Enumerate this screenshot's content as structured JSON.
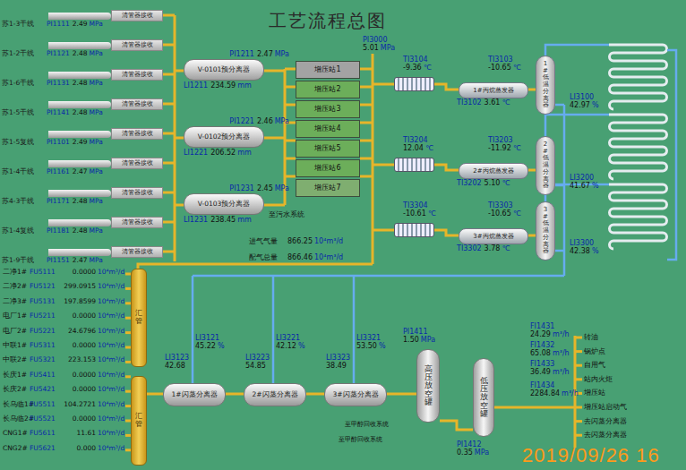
{
  "title": "工艺流程总图",
  "inlets": [
    {
      "name": "苏1-3干线",
      "tag": "PI1111",
      "value": "2.49",
      "unit": "MPa",
      "receiver": "清管器接收"
    },
    {
      "name": "苏1-2干线",
      "tag": "PI1121",
      "value": "2.48",
      "unit": "MPa",
      "receiver": "清管器接收"
    },
    {
      "name": "苏1-6干线",
      "tag": "PI1131",
      "value": "2.48",
      "unit": "MPa",
      "receiver": "清管器接收"
    },
    {
      "name": "苏1-5干线",
      "tag": "PI1141",
      "value": "2.48",
      "unit": "MPa",
      "receiver": "清管器接收"
    },
    {
      "name": "苏1-5复线",
      "tag": "PI1101",
      "value": "2.49",
      "unit": "MPa",
      "receiver": "清管器接收"
    },
    {
      "name": "苏1-4干线",
      "tag": "PI1161",
      "value": "2.47",
      "unit": "MPa",
      "receiver": "清管器接收"
    },
    {
      "name": "苏4-3干线",
      "tag": "PI1171",
      "value": "2.48",
      "unit": "MPa",
      "receiver": "清管器接收"
    },
    {
      "name": "苏1-4复线",
      "tag": "PI1181",
      "value": "2.48",
      "unit": "MPa",
      "receiver": "清管器接收"
    },
    {
      "name": "苏1-9干线",
      "tag": "PI1151",
      "value": "2.47",
      "unit": "MPa",
      "receiver": "清管器接收"
    }
  ],
  "separators": [
    {
      "name": "V-0101预分离器",
      "pressure_tag": "PI1211",
      "pressure": "2.47",
      "pressure_unit": "MPa",
      "level_tag": "LI1211",
      "level": "234.59",
      "level_unit": "mm"
    },
    {
      "name": "V-0102预分离器",
      "pressure_tag": "PI1221",
      "pressure": "2.46",
      "pressure_unit": "MPa",
      "level_tag": "LI1221",
      "level": "206.52",
      "level_unit": "mm"
    },
    {
      "name": "V-0103预分离器",
      "pressure_tag": "PI1231",
      "pressure": "2.45",
      "pressure_unit": "MPa",
      "level_tag": "LI1231",
      "level": "238.45",
      "level_unit": "mm"
    }
  ],
  "drain_label": "至污水系统",
  "boosters": {
    "outlet_tag": "PI3000",
    "outlet_value": "5.01",
    "outlet_unit": "MPa",
    "stations": [
      {
        "name": "增压站1",
        "color": "#a3a3a3"
      },
      {
        "name": "增压站2",
        "color": "#6cae5a"
      },
      {
        "name": "增压站3",
        "color": "#6cae5a"
      },
      {
        "name": "增压站4",
        "color": "#6cae5a"
      },
      {
        "name": "增压站5",
        "color": "#6cae5a"
      },
      {
        "name": "增压站6",
        "color": "#6cae5a"
      },
      {
        "name": "增压站7",
        "color": "#7fae70"
      }
    ]
  },
  "totals": [
    {
      "label": "进气气量",
      "value": "866.25",
      "unit": "10⁴m³/d"
    },
    {
      "label": "配气总量",
      "value": "866.46",
      "unit": "10⁴m³/d"
    }
  ],
  "trains": [
    {
      "inlet_tag": "TI3104",
      "inlet_value": "-9.36",
      "evap_tag": "TI3103",
      "evap_value": "-10.65",
      "evaporator": "1#丙烷蒸发器",
      "out_tag": "TI3102",
      "out_value": "3.61",
      "unit": "℃",
      "separator": "1#低温分离器",
      "level_tag": "LI3100",
      "level_value": "42.97",
      "level_unit": "%"
    },
    {
      "inlet_tag": "TI3204",
      "inlet_value": "12.04",
      "evap_tag": "TI3203",
      "evap_value": "-11.92",
      "evaporator": "2#丙烷蒸发器",
      "out_tag": "TI3202",
      "out_value": "5.10",
      "unit": "℃",
      "separator": "2#低温分离器",
      "level_tag": "LI3200",
      "level_value": "41.67",
      "level_unit": "%"
    },
    {
      "inlet_tag": "TI3304",
      "inlet_value": "-10.61",
      "evap_tag": "TI3303",
      "evap_value": "-10.65",
      "evaporator": "3#丙烷蒸发器",
      "out_tag": "TI3302",
      "out_value": "3.78",
      "unit": "℃",
      "separator": "3#低温分离器",
      "level_tag": "LI3300",
      "level_value": "42.38",
      "level_unit": "%"
    }
  ],
  "flows": [
    {
      "name": "二净1#",
      "tag": "FU5111",
      "value": "0.0000",
      "unit": "10⁴m³/d"
    },
    {
      "name": "二净2#",
      "tag": "FU5121",
      "value": "299.0915",
      "unit": "10⁴m³/d"
    },
    {
      "name": "二净3#",
      "tag": "FU5131",
      "value": "197.8599",
      "unit": "10⁴m³/d"
    },
    {
      "name": "电厂1#",
      "tag": "FU5211",
      "value": "0.0000",
      "unit": "10⁴m³/d"
    },
    {
      "name": "电厂2#",
      "tag": "FU5221",
      "value": "24.6796",
      "unit": "10⁴m³/d"
    },
    {
      "name": "中联1#",
      "tag": "FU5311",
      "value": "0.0000",
      "unit": "10⁴m³/d"
    },
    {
      "name": "中联2#",
      "tag": "FU5321",
      "value": "223.153",
      "unit": "10⁴m³/d"
    },
    {
      "name": "长庆1#",
      "tag": "FU5411",
      "value": "0.0000",
      "unit": "10⁴m³/d"
    },
    {
      "name": "长庆2#",
      "tag": "FU5421",
      "value": "0.0000",
      "unit": "10⁴m³/d"
    },
    {
      "name": "长乌临1#",
      "tag": "FU5511",
      "value": "104.2721",
      "unit": "10⁴m³/d"
    },
    {
      "name": "长乌临2#",
      "tag": "FU5521",
      "value": "0.0000",
      "unit": "10⁴m³/d"
    },
    {
      "name": "CNG1#",
      "tag": "FU5611",
      "value": "11.61",
      "unit": "10⁴m³/d"
    },
    {
      "name": "CNG2#",
      "tag": "FU5621",
      "value": "0.000",
      "unit": "10⁴m³/d"
    }
  ],
  "headers": [
    "汇管",
    "汇管"
  ],
  "flash": [
    {
      "name": "1#闪蒸分离器",
      "tag_a": "LI3123",
      "value_a": "42.68",
      "tag_b": "LI3121",
      "value_b": "45.22",
      "unit": "%"
    },
    {
      "name": "2#闪蒸分离器",
      "tag_a": "LI3223",
      "value_a": "54.85",
      "tag_b": "LI3221",
      "value_b": "42.12",
      "unit": "%"
    },
    {
      "name": "3#闪蒸分离器",
      "tag_a": "LI3323",
      "value_a": "38.49",
      "tag_b": "LI3321",
      "value_b": "53.50",
      "unit": "%"
    }
  ],
  "methanol_labels": [
    "至甲醇回收系统",
    "至甲醇回收系统"
  ],
  "hp_tank": {
    "name": "高压放空罐",
    "tag": "PI1411",
    "value": "1.50",
    "unit": "MPa"
  },
  "lp_tank": {
    "name": "低压放空罐",
    "tag": "PI1412",
    "value": "0.35",
    "unit": "MPa"
  },
  "consumers": {
    "meters": [
      {
        "tag": "FI1431",
        "value": "24.29",
        "unit": "m³/h"
      },
      {
        "tag": "FI1432",
        "value": "65.08",
        "unit": "m³/h"
      },
      {
        "tag": "FI1433",
        "value": "36.49",
        "unit": "m³/h"
      },
      {
        "tag": "FI1434",
        "value": "2284.84",
        "unit": "m³/h"
      }
    ],
    "destinations": [
      "转油",
      "锅炉点",
      "自用气",
      "站内火炬",
      "增压站",
      "增压站启动气",
      "去闪蒸分离器",
      "去闪蒸分离器"
    ]
  },
  "timestamp": "2019/09/26 16"
}
